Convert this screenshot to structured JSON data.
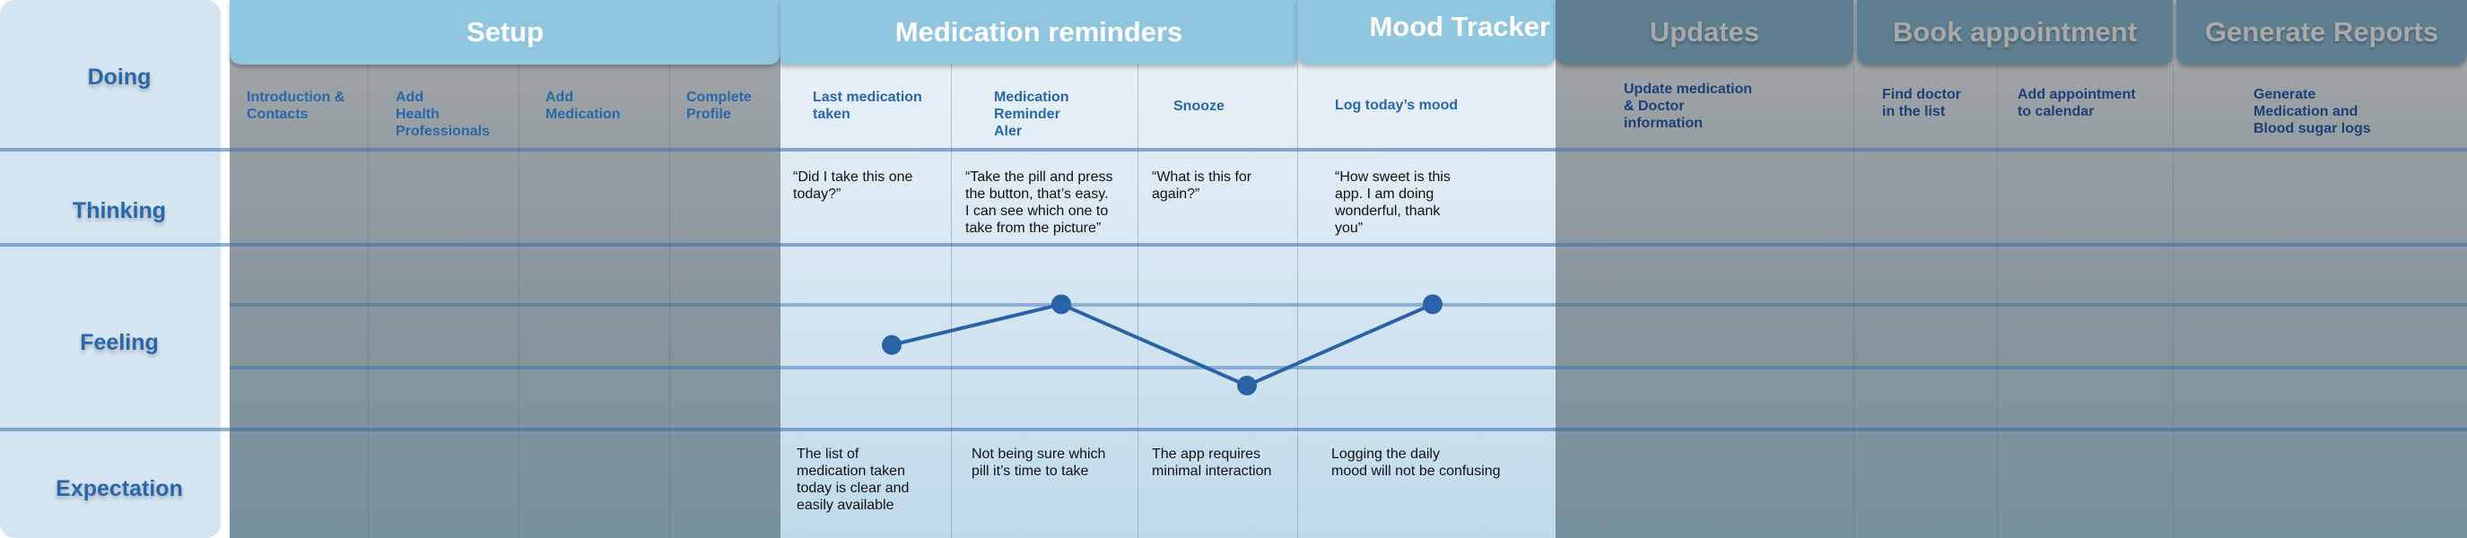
{
  "rows": {
    "doing": "Doing",
    "thinking": "Thinking",
    "feeling": "Feeling",
    "expectation": "Expectation"
  },
  "phases": {
    "setup": "Setup",
    "medication": "Medication reminders",
    "mood": "Mood Tracker",
    "updates": "Updates",
    "book": "Book appointment",
    "reports": "Generate Reports"
  },
  "steps": {
    "intro": "Introduction &\nContacts",
    "health": "Add\nHealth\nProfessionals",
    "add_medication": "Add\n Medication",
    "profile": "Complete\nProfile",
    "last_taken": "Last medication\ntaken",
    "reminder": "Medication\nReminder\nAler",
    "snooze": "Snooze",
    "log_mood": "Log today’s mood",
    "update_info": "Update medication\n& Doctor\ninformation",
    "find_doctor": "Find doctor\n in the list",
    "add_calendar": "Add appointment\nto calendar",
    "generate_logs": "Generate\nMedication and\nBlood sugar logs"
  },
  "thinking": {
    "last_taken": " “Did I take this one\ntoday?”",
    "reminder": "“Take the pill and press\nthe button, that’s easy.\nI can see which one to\ntake from the picture”",
    "snooze": "“What is this for\nagain?”",
    "log_mood": "“How sweet is this\napp. I am doing\nwonderful, thank\nyou”"
  },
  "expectation": {
    "last_taken": "The list of\nmedication taken\ntoday is clear and\neasily available",
    "reminder": "Not being sure which\npill it’s time to take",
    "snooze": "The app requires\nminimal interaction",
    "log_mood": "Logging the daily\nmood will not be confusing"
  },
  "chart_data": {
    "type": "line",
    "categories": [
      "Last medication taken",
      "Medication Reminder Aler",
      "Snooze",
      "Log today’s mood"
    ],
    "values": [
      2,
      3,
      1,
      3
    ],
    "ylim": [
      1,
      4
    ],
    "levels": 4,
    "line_color": "#2a62a6",
    "grid": true
  },
  "colors": {
    "accent": "#2a67aa",
    "active_header": "#8fc5df",
    "dim_header": "#5e7f92"
  }
}
